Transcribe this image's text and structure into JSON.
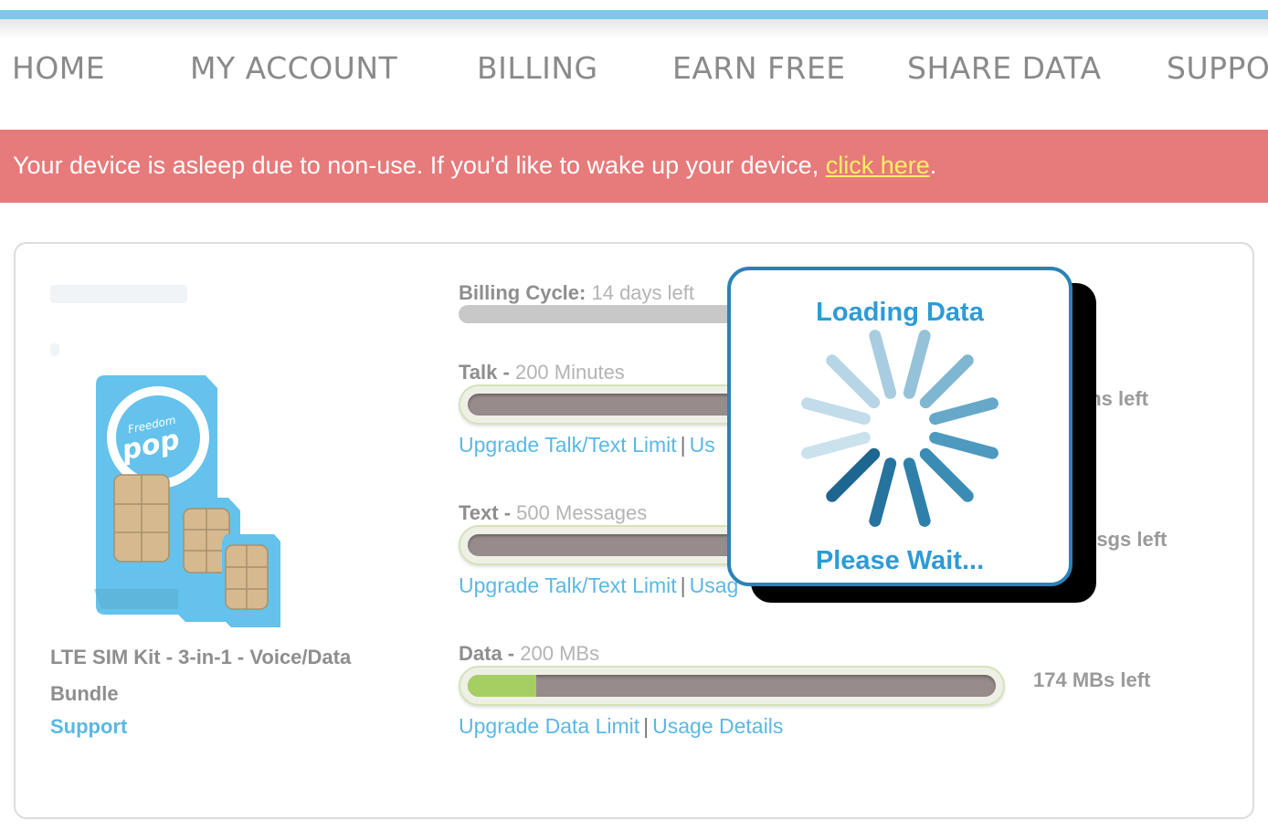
{
  "nav": {
    "items": [
      "HOME",
      "MY ACCOUNT",
      "BILLING",
      "EARN FREE",
      "SHARE DATA",
      "SUPPOR"
    ]
  },
  "alert": {
    "message": "Your device is asleep due to non-use. If you'd like to wake up your device, ",
    "link": "click here",
    "end": "."
  },
  "product": {
    "name": "LTE SIM Kit - 3-in-1 - Voice/Data Bundle",
    "support": "Support",
    "sim_brand_line1": "Freedom",
    "sim_brand_line2": "pop"
  },
  "billing": {
    "label": "Billing Cycle:",
    "value": "14 days left"
  },
  "talk": {
    "label": "Talk -",
    "value": "200 Minutes",
    "upgrade": "Upgrade Talk/Text Limit",
    "sep": "|",
    "usage_partial": "Us",
    "remaining_partial": "lins left"
  },
  "text": {
    "label": "Text -",
    "value": "500 Messages",
    "upgrade": "Upgrade Talk/Text Limit",
    "sep": "|",
    "usage_partial": "Usag",
    "remaining_partial": "Msgs left"
  },
  "data": {
    "label": "Data -",
    "value": "200 MBs",
    "upgrade": "Upgrade Data Limit",
    "sep": "|",
    "usage": "Usage Details",
    "remaining": "174 MBs left",
    "used_fraction": 0.13
  },
  "modal": {
    "title": "Loading Data",
    "subtitle": "Please Wait..."
  },
  "colors": {
    "accent": "#5ab8e4",
    "alert_bg": "#e77a7a",
    "alert_link": "#ffee66",
    "modal_border": "#2a82b8",
    "data_fill": "#a6cf63"
  }
}
